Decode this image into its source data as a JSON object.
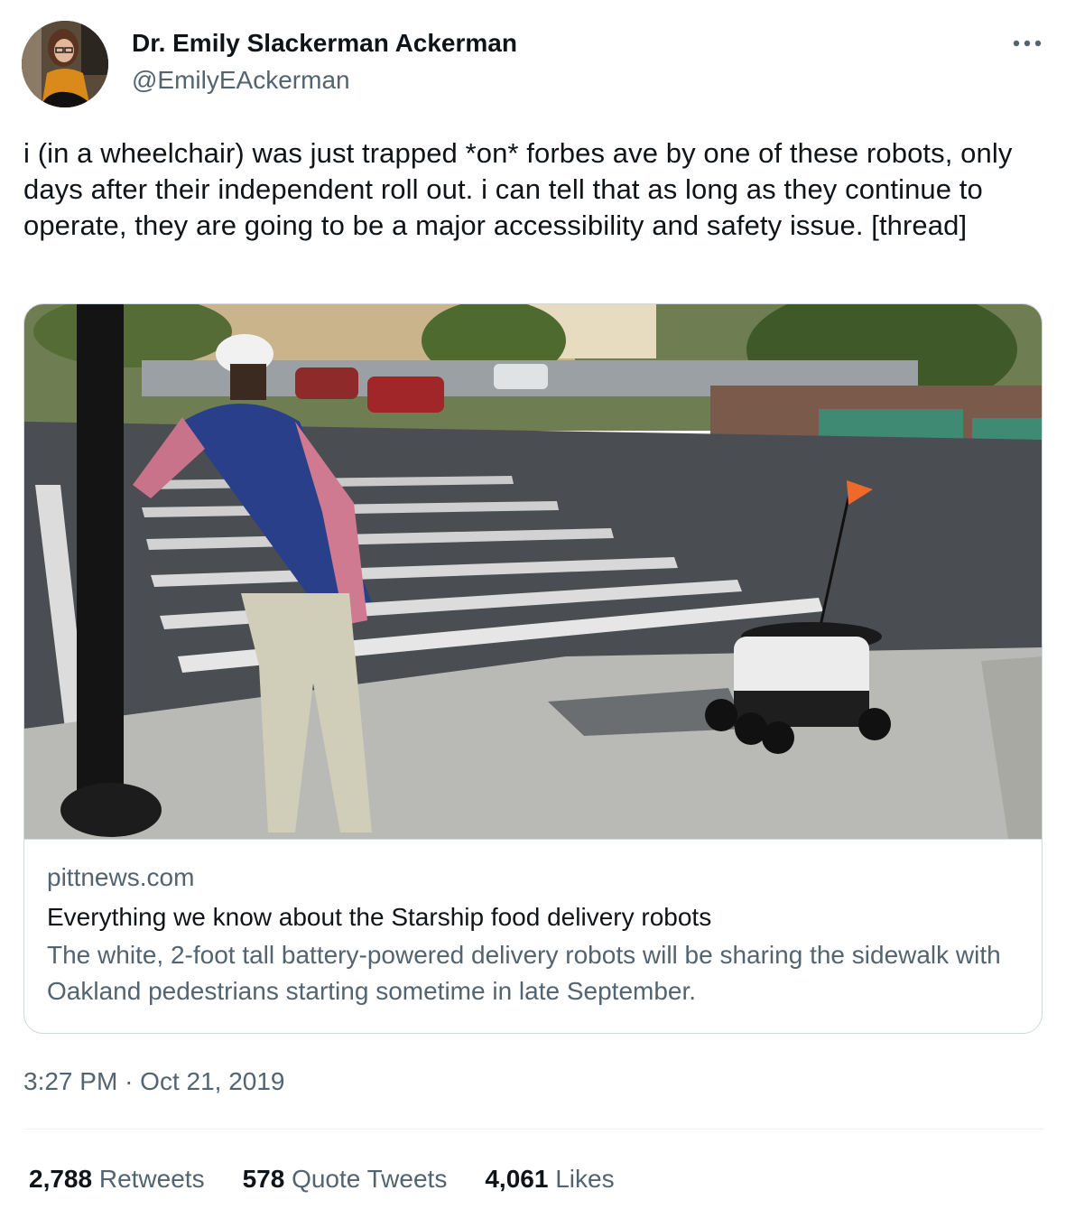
{
  "author": {
    "display_name": "Dr. Emily Slackerman Ackerman",
    "handle": "@EmilyEAckerman"
  },
  "tweet": {
    "text": "i (in a wheelchair) was just trapped *on* forbes ave by one of these robots, only days after their independent roll out. i can tell that as long as they continue to operate, they are going to be a major accessibility and safety issue. [thread]"
  },
  "link_card": {
    "domain": "pittnews.com",
    "title": "Everything we know about the Starship food delivery robots",
    "description": "The white, 2-foot tall battery-powered delivery robots will be sharing the sidewalk with Oakland pedestrians starting sometime in late September."
  },
  "meta": {
    "time": "3:27 PM",
    "separator": "·",
    "date": "Oct 21, 2019"
  },
  "stats": {
    "retweets_count": "2,788",
    "retweets_label": "Retweets",
    "quotes_count": "578",
    "quotes_label": "Quote Tweets",
    "likes_count": "4,061",
    "likes_label": "Likes"
  },
  "icons": {
    "more": "more-horizontal-icon"
  },
  "colors": {
    "text_primary": "#0f1419",
    "text_secondary": "#536471",
    "border": "#cfd9de"
  }
}
